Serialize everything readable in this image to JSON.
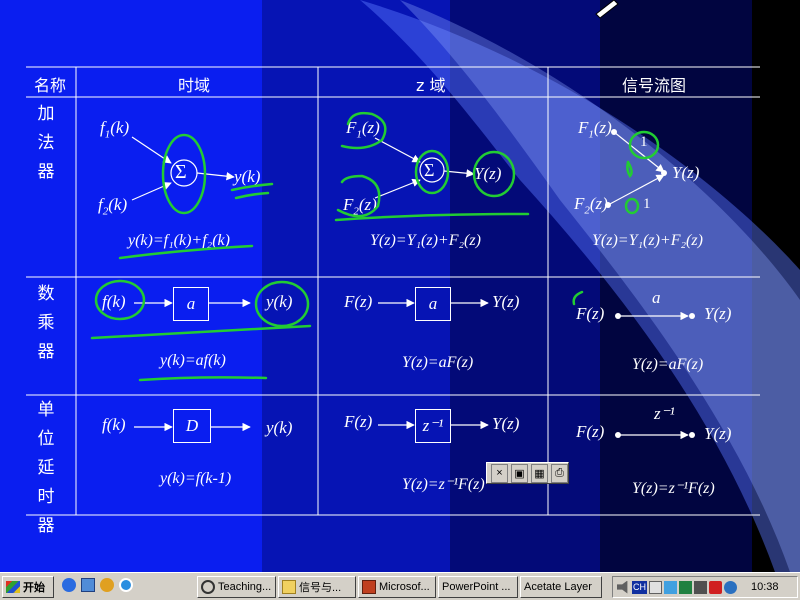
{
  "table": {
    "headers": [
      "名称",
      "时域",
      "z 域",
      "信号流图"
    ],
    "rows": [
      {
        "name": "加法器"
      },
      {
        "name": "数乘器"
      },
      {
        "name": "单位延时器"
      }
    ]
  },
  "adder": {
    "time": {
      "in1": "f",
      "in1sub": "1",
      "in1arg": "(k)",
      "in2": "f",
      "in2sub": "2",
      "in2arg": "(k)",
      "symbol": "Σ",
      "out": "y(k)",
      "eq": "y(k)=f₁(k)+f₂(k)"
    },
    "z": {
      "in1": "F",
      "in1sub": "1",
      "in1arg": "(z)",
      "in2": "F",
      "in2sub": "2",
      "in2arg": "(z)",
      "symbol": "Σ",
      "out": "Y(z)",
      "eq": "Y(z)=Y₁(z)+F₂(z)"
    },
    "flow": {
      "in1": "F",
      "in1sub": "1",
      "in1arg": "(z)",
      "in2": "F",
      "in2sub": "2",
      "in2arg": "(z)",
      "gain1": "1",
      "gain2": "1",
      "out": "Y(z)",
      "eq": "Y(z)=Y₁(z)+F₂(z)"
    }
  },
  "multiplier": {
    "time": {
      "in": "f(k)",
      "block": "a",
      "out": "y(k)",
      "eq": "y(k)=af(k)"
    },
    "z": {
      "in": "F(z)",
      "block": "a",
      "out": "Y(z)",
      "eq": "Y(z)=aF(z)"
    },
    "flow": {
      "in": "F(z)",
      "gain": "a",
      "out": "Y(z)",
      "eq": "Y(z)=aF(z)"
    }
  },
  "delay": {
    "time": {
      "in": "f(k)",
      "block": "D",
      "out": "y(k)",
      "eq": "y(k)=f(k-1)"
    },
    "z": {
      "in": "F(z)",
      "block": "z⁻¹",
      "out": "Y(z)",
      "eq": "Y(z)=z⁻¹F(z)"
    },
    "flow": {
      "in": "F(z)",
      "gain": "z⁻¹",
      "out": "Y(z)",
      "eq": "Y(z)=z⁻¹F(z)"
    }
  },
  "taskbar": {
    "start_label": "开始",
    "tasks": [
      "Teaching...",
      "信号与...",
      "Microsof...",
      "PowerPoint ...",
      "Acetate Layer"
    ],
    "lang": "CH",
    "clock": "10:38"
  },
  "colors": {
    "accent_pen": "#22cc33",
    "slide_blue": "#0a1ef0"
  }
}
